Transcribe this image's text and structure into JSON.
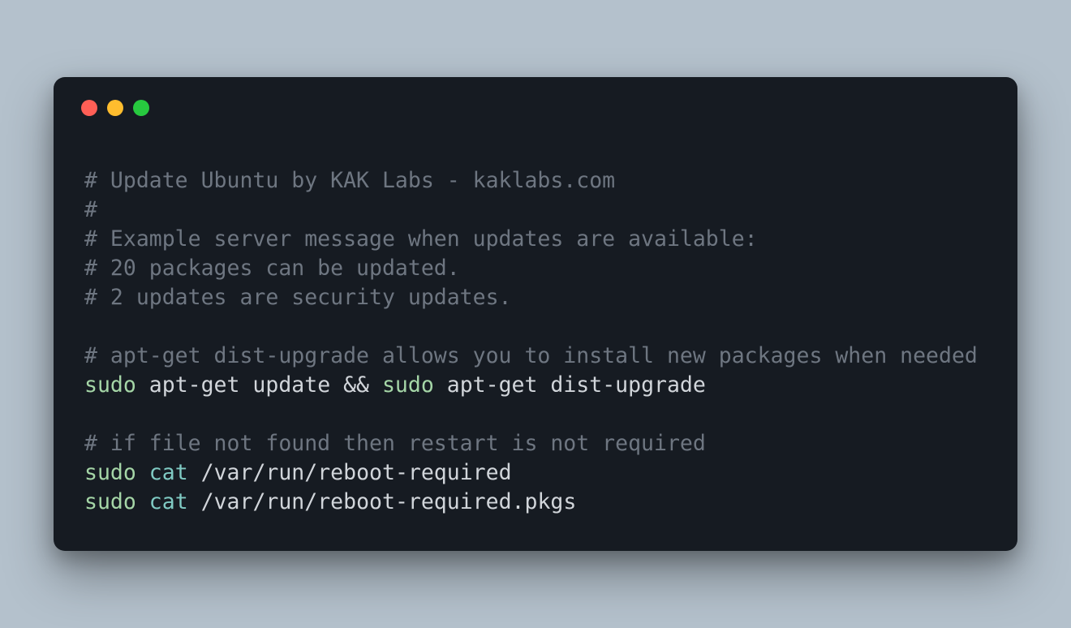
{
  "lines": {
    "c1": "# Update Ubuntu by KAK Labs - kaklabs.com",
    "c2": "#",
    "c3": "# Example server message when updates are available:",
    "c4": "# 20 packages can be updated.",
    "c5": "# 2 updates are security updates.",
    "c6": "# apt-get dist-upgrade allows you to install new packages when needed",
    "l7_sudo1": "sudo",
    "l7_mid": " apt-get update && ",
    "l7_sudo2": "sudo",
    "l7_end": " apt-get dist-upgrade",
    "c8": "# if file not found then restart is not required",
    "l9_sudo": "sudo",
    "l9_sp": " ",
    "l9_cat": "cat",
    "l9_path": " /var/run/reboot-required",
    "l10_sudo": "sudo",
    "l10_sp": " ",
    "l10_cat": "cat",
    "l10_path": " /var/run/reboot-required.pkgs"
  },
  "colors": {
    "background_page": "#b4c1cc",
    "background_terminal": "#161b22",
    "comment": "#6e7681",
    "sudo": "#a5d6a7",
    "cat": "#7fcac3",
    "text": "#d1d5da",
    "dot_red": "#ff5f56",
    "dot_yellow": "#ffbd2e",
    "dot_green": "#27c93f"
  }
}
